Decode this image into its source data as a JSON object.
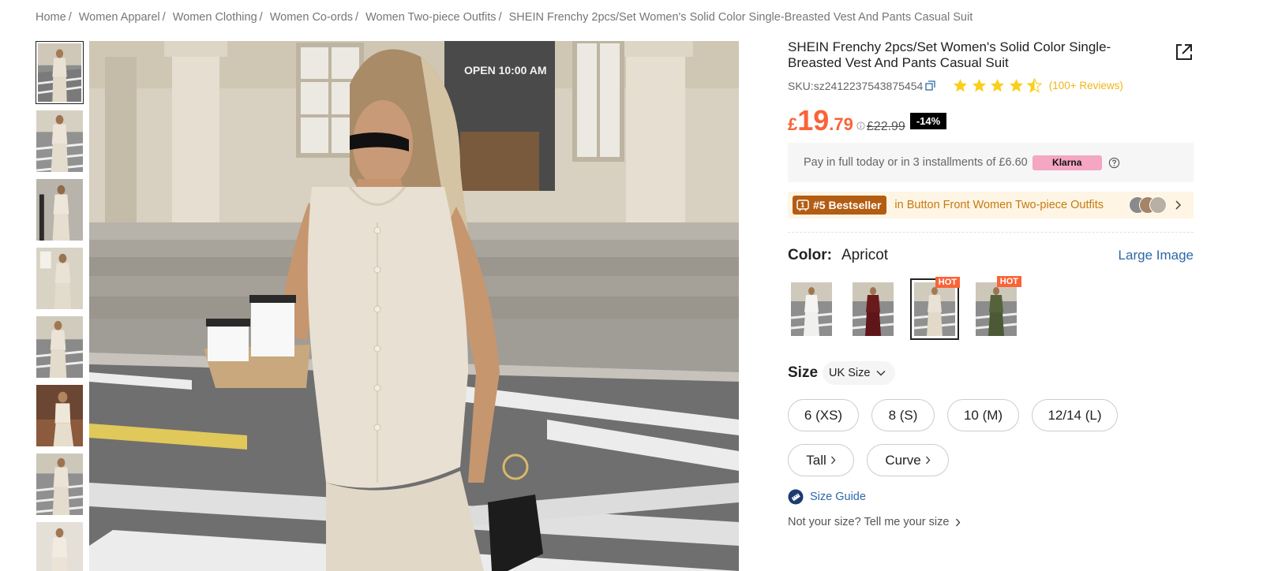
{
  "breadcrumb": [
    {
      "label": "Home"
    },
    {
      "label": "Women Apparel"
    },
    {
      "label": "Women Clothing"
    },
    {
      "label": "Women Co-ords"
    },
    {
      "label": "Women Two-piece Outfits"
    },
    {
      "label": "SHEIN Frenchy 2pcs/Set Women's Solid Color Single-Breasted Vest And Pants Casual Suit"
    }
  ],
  "breadcrumb_sep": "/",
  "main_image": {
    "sign_text": "OPEN 10:00 AM"
  },
  "product": {
    "title": "SHEIN Frenchy 2pcs/Set Women's Solid Color Single-Breasted Vest And Pants Casual Suit",
    "sku_prefix": "SKU: ",
    "sku": "sz2412237543875454",
    "rating": 4.5,
    "reviews": "(100+ Reviews)"
  },
  "price": {
    "currency": "£",
    "main": "19",
    "decimal": ".79",
    "original": "£22.99",
    "discount": "-14%",
    "color": "#fa6338"
  },
  "klarna": {
    "text": "Pay in full today or in 3 installments of £6.60",
    "badge": "Klarna"
  },
  "bestseller": {
    "badge": "#5 Bestseller",
    "text": "in Button Front Women Two-piece Outfits"
  },
  "color": {
    "label": "Color:",
    "value": "Apricot",
    "large_image": "Large Image",
    "swatches": [
      {
        "name": "white",
        "hot": ""
      },
      {
        "name": "burgundy",
        "hot": ""
      },
      {
        "name": "apricot",
        "hot": "HOT",
        "selected": true
      },
      {
        "name": "olive",
        "hot": "HOT"
      }
    ]
  },
  "size": {
    "label": "Size",
    "system": "UK Size",
    "options": [
      "6 (XS)",
      "8 (S)",
      "10 (M)",
      "12/14 (L)"
    ],
    "fits": [
      "Tall",
      "Curve"
    ],
    "guide": "Size Guide",
    "not_your_size": "Not your size? Tell me your size"
  }
}
